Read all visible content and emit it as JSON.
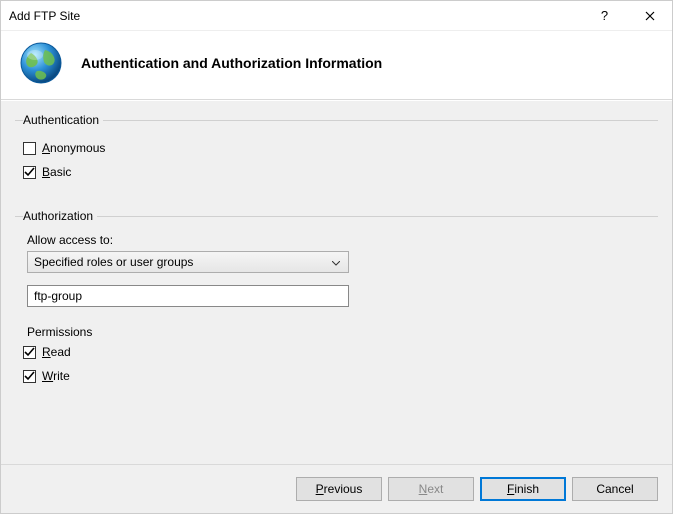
{
  "window": {
    "title": "Add FTP Site"
  },
  "header": {
    "title": "Authentication and Authorization Information"
  },
  "auth_section": {
    "legend": "Authentication",
    "anonymous": {
      "label_pre": "A",
      "label_rest": "nonymous",
      "checked": false
    },
    "basic": {
      "label_pre": "B",
      "label_rest": "asic",
      "checked": true
    }
  },
  "authorization_section": {
    "legend": "Authorization",
    "allow_label": "Allow access to:",
    "select_value": "Specified roles or user groups",
    "input_value": "ftp-group",
    "permissions_label": "Permissions",
    "read": {
      "label_pre": "R",
      "label_rest": "ead",
      "checked": true
    },
    "write": {
      "label_pre": "W",
      "label_rest": "rite",
      "checked": true
    }
  },
  "buttons": {
    "previous_pre": "P",
    "previous_rest": "revious",
    "next_pre": "N",
    "next_rest": "ext",
    "finish_pre": "F",
    "finish_rest": "inish",
    "cancel": "Cancel"
  }
}
